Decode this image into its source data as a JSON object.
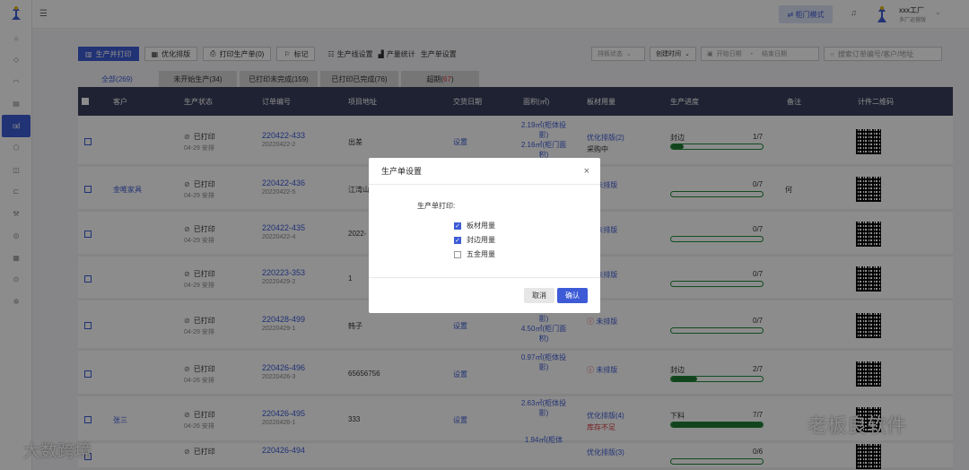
{
  "topbar": {
    "mode_button": "⇄ 柜门模式",
    "factory_name": "xxx工厂",
    "factory_sub": "多厂运营版"
  },
  "toolbar": {
    "buttons": [
      "生产并打印",
      "优化排版",
      "打印生产单(0)",
      "标记"
    ],
    "links": [
      "生产线设置",
      "产量统计",
      "生产单设置"
    ],
    "filter_status": "排板状态",
    "filter_time": "创建时间",
    "date_start": "开始日期",
    "date_sep": "-",
    "date_end": "结束日期",
    "search_placeholder": "搜索订单编号/客户/地址"
  },
  "tabs": [
    {
      "label": "全部(269)"
    },
    {
      "label": "未开始生产(34)"
    },
    {
      "label": "已打印未完成(159)"
    },
    {
      "label": "已打印已完成(76)"
    },
    {
      "label_prefix": "超期(",
      "label_count": "67",
      "label_suffix": ")"
    }
  ],
  "table": {
    "headers": [
      "客户",
      "生产状态",
      "订单编号",
      "项目地址",
      "交货日期",
      "面积(㎡)",
      "板材用量",
      "生产进度",
      "备注",
      "计件二维码"
    ],
    "rows": [
      {
        "customer": "",
        "status": "已打印",
        "status_sub": "04-29 安排",
        "order": "220422-433",
        "order_sub": "20220422-2",
        "address": "出差",
        "delivery": "设置",
        "area": "2.19㎡(柜体投影)\n2.16㎡(柜门面积)",
        "material": "优化排版(2)",
        "material_sub": "采购中",
        "material_warn": false,
        "progress_label": "封边",
        "progress_text": "1/7",
        "progress": 0.14,
        "note": ""
      },
      {
        "customer": "金唯家具",
        "status": "已打印",
        "status_sub": "04-29 安排",
        "order": "220422-436",
        "order_sub": "20220422-5",
        "address": "江湾山",
        "delivery": "",
        "area": "",
        "material": "未排版",
        "material_sub": "",
        "material_warn": true,
        "progress_label": "",
        "progress_text": "0/7",
        "progress": 0,
        "note": "何"
      },
      {
        "customer": "",
        "status": "已打印",
        "status_sub": "04-29 安排",
        "order": "220422-435",
        "order_sub": "20220422-4",
        "address": "2022-",
        "delivery": "",
        "area": "",
        "material": "未排版",
        "material_sub": "",
        "material_warn": true,
        "progress_label": "",
        "progress_text": "0/7",
        "progress": 0,
        "note": ""
      },
      {
        "customer": "",
        "status": "已打印",
        "status_sub": "04-29 安排",
        "order": "220223-353",
        "order_sub": "20220429-2",
        "address": "1",
        "delivery": "",
        "area": "",
        "material": "未排版",
        "material_sub": "",
        "material_warn": true,
        "progress_label": "",
        "progress_text": "0/7",
        "progress": 0,
        "note": ""
      },
      {
        "customer": "",
        "status": "已打印",
        "status_sub": "04-29 安排",
        "order": "220428-499",
        "order_sub": "20220429-1",
        "address": "韩子",
        "delivery": "设置",
        "area": "27.95㎡(柜体投影)\n4.50㎡(柜门面积)",
        "material": "未排版",
        "material_sub": "",
        "material_warn": true,
        "progress_label": "",
        "progress_text": "0/7",
        "progress": 0,
        "note": ""
      },
      {
        "customer": "",
        "status": "已打印",
        "status_sub": "04-26 安排",
        "order": "220426-496",
        "order_sub": "20220426-3",
        "address": "65656756",
        "delivery": "设置",
        "area": "0.97㎡(柜体投影)",
        "material": "未排版",
        "material_sub": "",
        "material_warn": true,
        "progress_label": "封边",
        "progress_text": "2/7",
        "progress": 0.286,
        "note": ""
      },
      {
        "customer": "张三",
        "status": "已打印",
        "status_sub": "04-26 安排",
        "order": "220426-495",
        "order_sub": "20220426-1",
        "address": "333",
        "delivery": "设置",
        "area": "2.63㎡(柜体投影)",
        "material": "优化排版(4)",
        "material_sub": "库存不足",
        "material_warn": false,
        "progress_label": "下料",
        "progress_text": "7/7",
        "progress": 1.0,
        "note": ""
      },
      {
        "customer": "",
        "status": "已打印",
        "status_sub": "",
        "order": "220426-494",
        "order_sub": "",
        "address": "",
        "delivery": "",
        "area": "1.94㎡(柜体",
        "material": "优化排版(3)",
        "material_sub": "",
        "material_warn": false,
        "progress_label": "",
        "progress_text": "0/6",
        "progress": 0,
        "note": ""
      }
    ]
  },
  "modal": {
    "title": "生产单设置",
    "close": "×",
    "section_label": "生产单打印:",
    "options": [
      {
        "label": "板材用量",
        "checked": true
      },
      {
        "label": "封边用量",
        "checked": true
      },
      {
        "label": "五金用量",
        "checked": false
      }
    ],
    "cancel": "取消",
    "confirm": "确认"
  },
  "watermarks": {
    "left": "大数跨境",
    "right": "老板良软件"
  },
  "colors": {
    "accent": "#3d5bd6",
    "header_bg": "#3a3f5c",
    "progress": "#1f7a33",
    "danger": "#d9363e"
  }
}
